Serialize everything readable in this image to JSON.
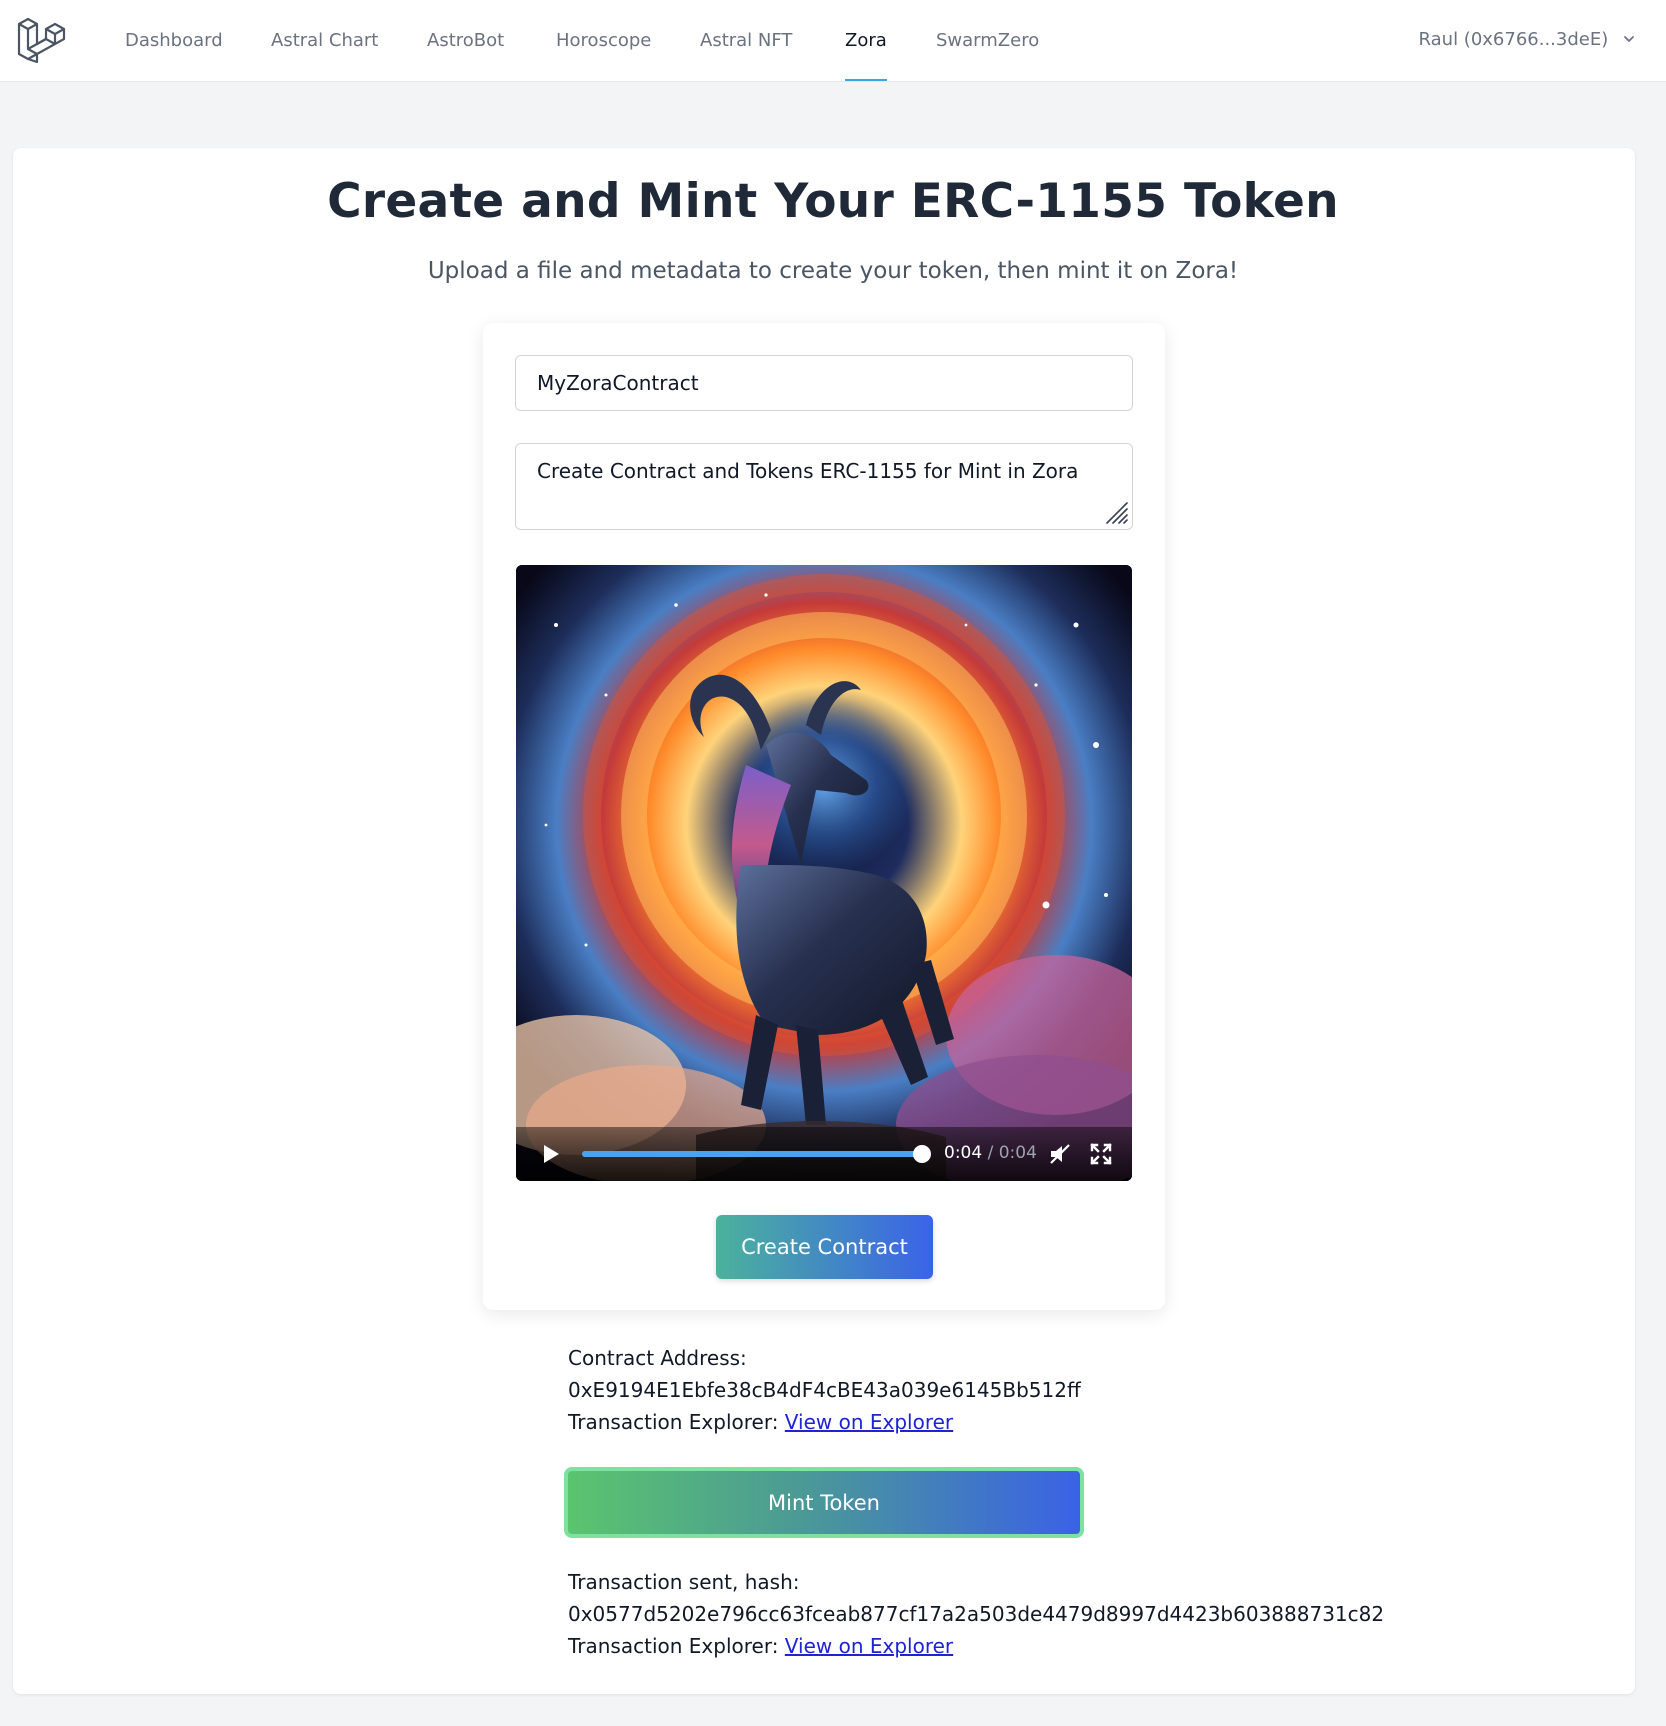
{
  "nav": {
    "links": [
      {
        "label": "Dashboard"
      },
      {
        "label": "Astral Chart"
      },
      {
        "label": "AstroBot"
      },
      {
        "label": "Horoscope"
      },
      {
        "label": "Astral NFT"
      },
      {
        "label": "Zora",
        "active": true
      },
      {
        "label": "SwarmZero"
      }
    ],
    "user_label": "Raul (0x6766...3deE)",
    "logo_icon": "laravel-logo-icon"
  },
  "page": {
    "title": "Create and Mint Your ERC-1155 Token",
    "subtitle": "Upload a file and metadata to create your token, then mint it on Zora!"
  },
  "form": {
    "contract_name_value": "MyZoraContract",
    "description_value": "Create Contract and Tokens ERC-1155 for Mint in Zora",
    "create_button_label": "Create Contract"
  },
  "video": {
    "current_time": "0:04",
    "duration": " / 0:04",
    "progress": 1.0,
    "muted": true
  },
  "contract_result": {
    "address_label": "Contract Address:",
    "address_value": "0xE9194E1Ebfe38cB4dF4cBE43a039e6145Bb512ff",
    "explorer_label": "Transaction Explorer: ",
    "explorer_link": "View on Explorer"
  },
  "mint": {
    "button_label": "Mint Token",
    "hash_label": "Transaction sent, hash:",
    "hash_value": "0x0577d5202e796cc63fceab877cf17a2a503de4479d8997d4423b603888731c82",
    "explorer_label": "Transaction Explorer: ",
    "explorer_link": "View on Explorer"
  },
  "colors": {
    "nav_active_underline": "#38a5e8",
    "create_gradient_start": "#4bb29c",
    "create_gradient_end": "#3a63e8",
    "mint_gradient_start": "#5bc46e",
    "mint_gradient_end": "#3a62e6",
    "mint_focus_ring": "#7de1a0",
    "link": "#1d24d8",
    "video_progress": "#4aa3f2"
  }
}
